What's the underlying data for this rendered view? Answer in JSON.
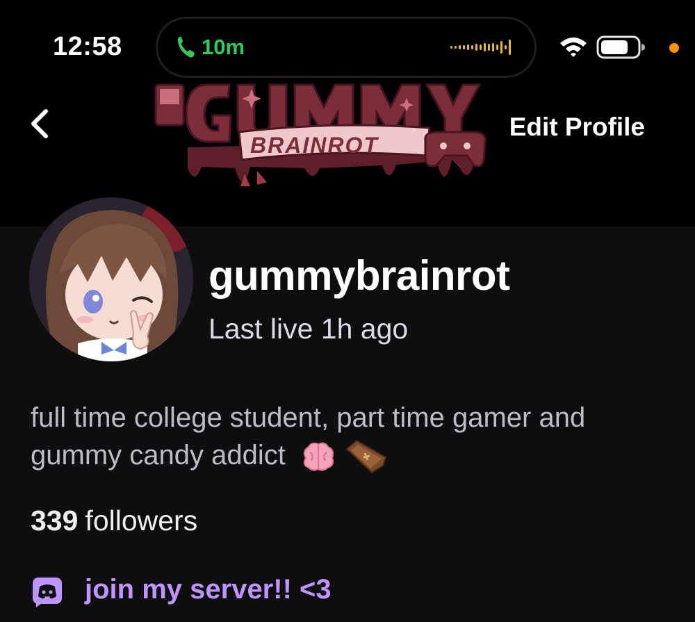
{
  "status_bar": {
    "time": "12:58",
    "call_duration": "10m",
    "icons": [
      "phone-icon",
      "audio-waveform-icon",
      "wifi-icon",
      "battery-icon"
    ]
  },
  "header": {
    "edit_label": "Edit Profile",
    "banner_text": "GUMMY BRAINROT"
  },
  "profile": {
    "username": "gummybrainrot",
    "last_live": "Last live 1h ago",
    "bio": "full time college student, part time gamer and gummy candy addict",
    "bio_emojis": [
      "brain-emoji",
      "coffin-emoji"
    ],
    "followers_count": "339",
    "followers_label": "followers",
    "link_label": "join my server!! <3",
    "link_icon": "discord-icon"
  },
  "colors": {
    "background": "#0e0e10",
    "accent": "#bf94ff",
    "call_green": "#34c759",
    "privacy_dot": "#ff9500",
    "banner_logo": "#7a2e3a"
  }
}
